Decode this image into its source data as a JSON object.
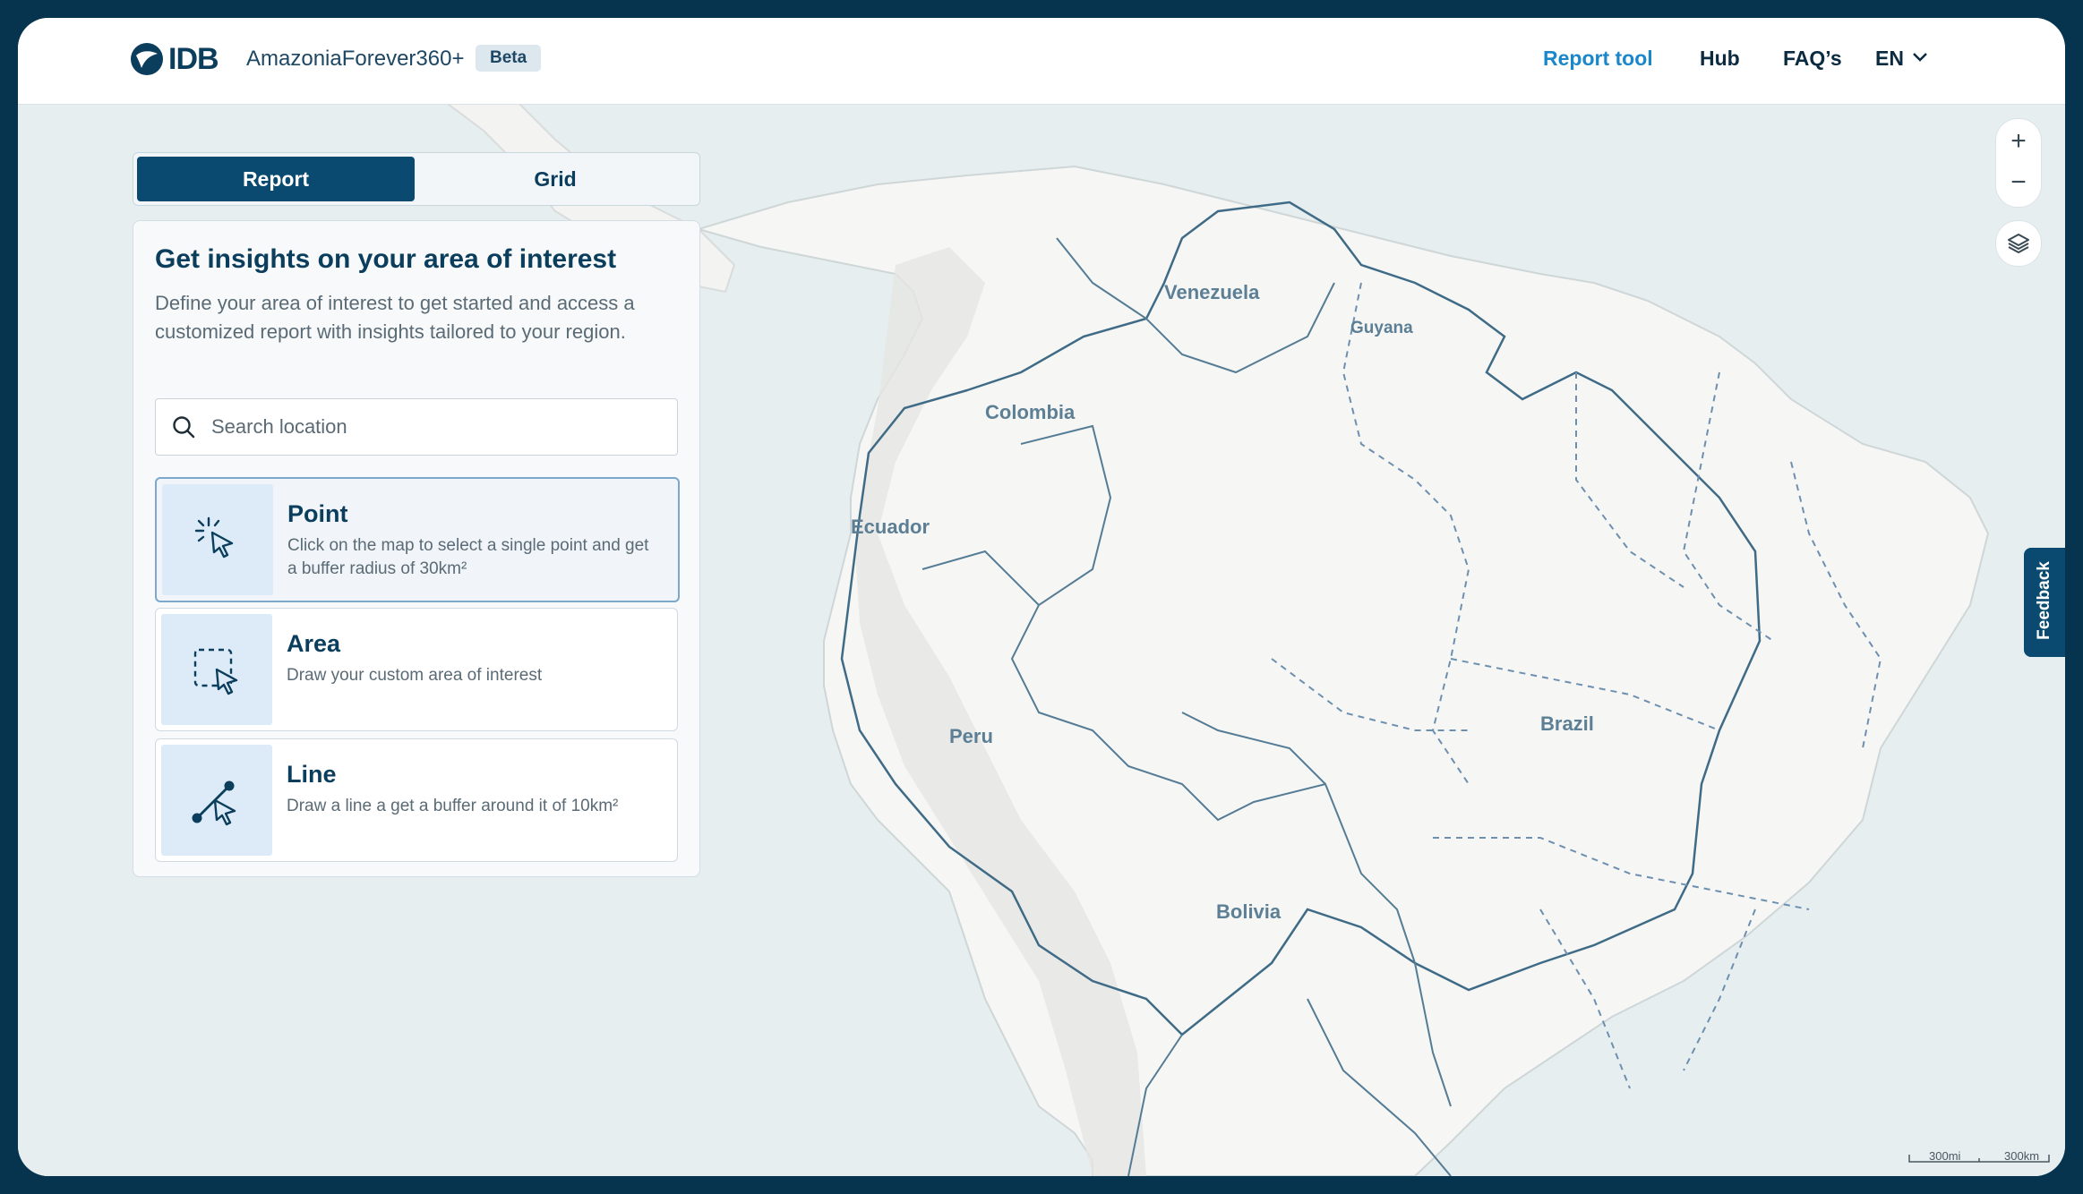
{
  "header": {
    "logo_text": "IDB",
    "app_name": "AmazoniaForever360+",
    "beta_badge": "Beta",
    "nav": {
      "report_tool": "Report tool",
      "hub": "Hub",
      "faqs": "FAQ’s",
      "language": "EN"
    },
    "accent_color": "#1b87c9",
    "brand_color": "#0b3d5c"
  },
  "tabs": [
    {
      "label": "Report",
      "active": true
    },
    {
      "label": "Grid",
      "active": false
    }
  ],
  "panel": {
    "title": "Get insights on your area of interest",
    "description": "Define your area of interest to get started and access a customized report with insights tailored to your region.",
    "search_placeholder": "Search location",
    "options": [
      {
        "title": "Point",
        "description": "Click on the map to select a single point and get a buffer radius of 30km²",
        "icon": "point-select-icon",
        "selected": true
      },
      {
        "title": "Area",
        "description": "Draw your custom area of interest",
        "icon": "area-select-icon",
        "selected": false
      },
      {
        "title": "Line",
        "description": "Draw a line a get a buffer around it of 10km²",
        "icon": "line-select-icon",
        "selected": false
      }
    ]
  },
  "map": {
    "country_labels": [
      "Venezuela",
      "Guyana",
      "Colombia",
      "Ecuador",
      "Peru",
      "Brazil",
      "Bolivia"
    ],
    "zoom_in": "+",
    "zoom_out": "−",
    "scale_imperial": "300mi",
    "scale_metric": "300km"
  },
  "feedback_label": "Feedback"
}
